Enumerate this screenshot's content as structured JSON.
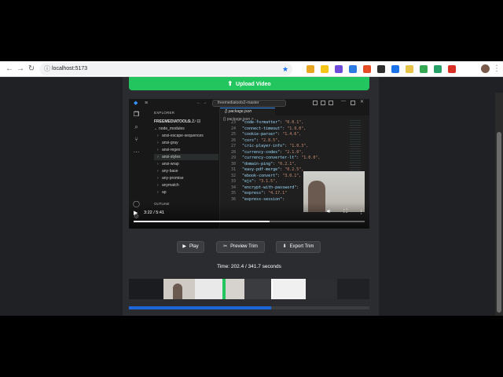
{
  "browser": {
    "url": "localhost:5173",
    "back_icon": "arrow-left-icon",
    "forward_icon": "arrow-right-icon",
    "reload_icon": "reload-icon",
    "extensions": [
      "#e8a623",
      "#f5c518",
      "#6d4bd8",
      "#2c7be5",
      "#e44d26",
      "#2f2f2f",
      "#1a73e8",
      "#e8c34a",
      "#34a853",
      "#26a269",
      "#d93025"
    ]
  },
  "app": {
    "upload_label": "Upload Video",
    "buttons": {
      "play": "Play",
      "preview": "Preview Trim",
      "export": "Export Trim"
    },
    "time_text": "Time: 202.4 / 341.7 seconds",
    "trim_progress": 0.59
  },
  "video": {
    "time_label": "3:22 / 5:41",
    "progress": 0.59,
    "vscode": {
      "search_text": "freemediatools2-master",
      "explorer_label": "EXPLORER",
      "root_label": "FREEMEDIATOOLS...",
      "outline_label": "OUTLINE",
      "tab_label": "{} package.json",
      "crumb": "{} package.json > ...",
      "tree": [
        {
          "label": "node_modules",
          "chev": "⌄"
        },
        {
          "label": "ansi-escape-sequences",
          "chev": "›"
        },
        {
          "label": "ansi-gray",
          "chev": "›"
        },
        {
          "label": "ansi-regex",
          "chev": "›"
        },
        {
          "label": "ansi-styles",
          "chev": "›"
        },
        {
          "label": "ansi-wrap",
          "chev": "›"
        },
        {
          "label": "any-base",
          "chev": "›"
        },
        {
          "label": "any-promise",
          "chev": "›"
        },
        {
          "label": "anymatch",
          "chev": "›"
        },
        {
          "label": "ap",
          "chev": "›"
        }
      ],
      "lines": [
        {
          "n": "23",
          "k": "\"code-formatter\"",
          "v": "\"0.0.1\","
        },
        {
          "n": "24",
          "k": "\"connect-timeout\"",
          "v": "\"1.9.0\","
        },
        {
          "n": "25",
          "k": "\"cookie-parser\"",
          "v": "\"1.4.6\","
        },
        {
          "n": "26",
          "k": "\"cors\"",
          "v": "\"2.8.5\","
        },
        {
          "n": "27",
          "k": "\"cric-player-info\"",
          "v": "\"1.0.3\","
        },
        {
          "n": "28",
          "k": "\"currency-codes\"",
          "v": "\"2.1.0\","
        },
        {
          "n": "29",
          "k": "\"currency-converter-lt\"",
          "v": "\"1.0.0\","
        },
        {
          "n": "30",
          "k": "\"domain-ping\"",
          "v": "\"0.2.1\","
        },
        {
          "n": "31",
          "k": "\"easy-pdf-merge\"",
          "v": "\"0.2.5\","
        },
        {
          "n": "32",
          "k": "\"ebook-convert\"",
          "v": "\"3.0.1\","
        },
        {
          "n": "33",
          "k": "\"ejs\"",
          "v": "\"3.1.5\","
        },
        {
          "n": "34",
          "k": "\"encrypt-with-password\"",
          "v": ""
        },
        {
          "n": "35",
          "k": "\"express\"",
          "v": "\"4.17.1\""
        },
        {
          "n": "36",
          "k": "\"express-session\"",
          "v": ""
        }
      ]
    }
  },
  "colors": {
    "accent_green": "#22c55e",
    "progress_blue": "#1e66d9"
  }
}
